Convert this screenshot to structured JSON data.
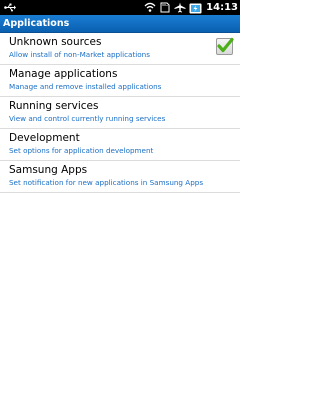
{
  "status_bar": {
    "time": "14:13",
    "icons": [
      "usb-icon",
      "wifi-icon",
      "sd-card-icon",
      "airplane-mode-icon",
      "battery-icon"
    ]
  },
  "header": {
    "title": "Applications",
    "color": "#0f6ec4"
  },
  "settings": {
    "items": [
      {
        "label": "Unknown sources",
        "summary": "Allow install of non-Market applications",
        "checked": true
      },
      {
        "label": "Manage applications",
        "summary": "Manage and remove installed applications"
      },
      {
        "label": "Running services",
        "summary": "View and control currently running services"
      },
      {
        "label": "Development",
        "summary": "Set options for application development"
      },
      {
        "label": "Samsung Apps",
        "summary": "Set notification for new applications in Samsung Apps"
      }
    ]
  },
  "colors": {
    "summary_text": "#1b6fc5",
    "checkmark": "#4caf1a"
  }
}
